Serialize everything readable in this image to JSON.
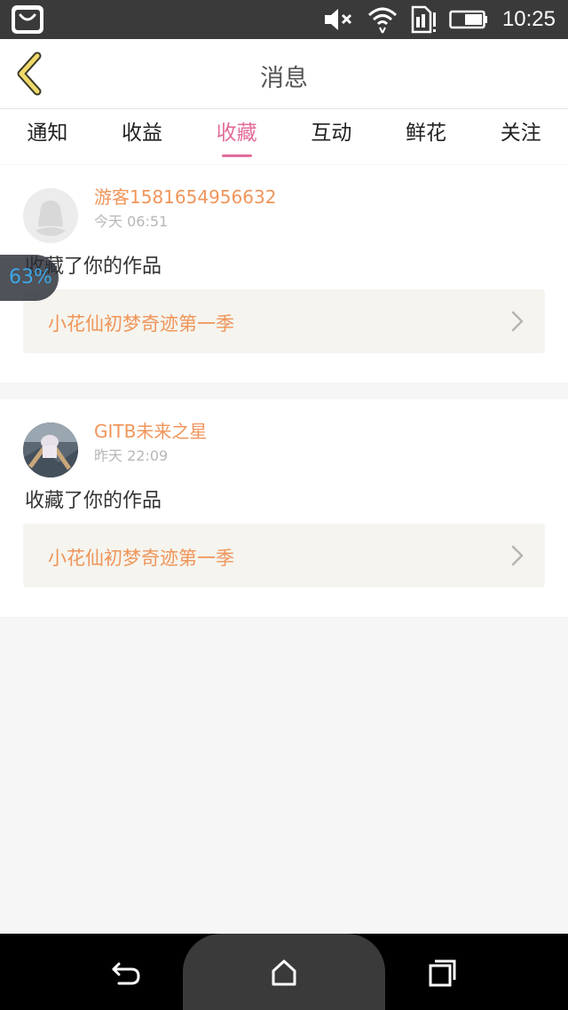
{
  "status_bar": {
    "time": "10:25",
    "icons": [
      "shopping-bag-icon",
      "volume-muted-icon",
      "wifi-icon",
      "sim-card-icon",
      "battery-icon"
    ]
  },
  "header": {
    "title": "消息",
    "back_icon": "chevron-left-icon"
  },
  "tabs": [
    {
      "label": "通知",
      "active": false
    },
    {
      "label": "收益",
      "active": false
    },
    {
      "label": "收藏",
      "active": true
    },
    {
      "label": "互动",
      "active": false
    },
    {
      "label": "鲜花",
      "active": false
    },
    {
      "label": "关注",
      "active": false
    }
  ],
  "floating_badge": {
    "text": "63%"
  },
  "messages": [
    {
      "username": "游客1581654956632",
      "time": "今天 06:51",
      "action": "收藏了你的作品",
      "work_title": "小花仙初梦奇迹第一季",
      "avatar": "default-avatar-icon"
    },
    {
      "username": "GITB未来之星",
      "time": "昨天 22:09",
      "action": "收藏了你的作品",
      "work_title": "小花仙初梦奇迹第一季",
      "avatar": "user-photo-avatar"
    }
  ],
  "colors": {
    "accent_pink": "#e36c9a",
    "accent_orange": "#f0955a",
    "back_arrow_yellow": "#f0d96a"
  },
  "nav_bar": {
    "icons": [
      "back-nav-icon",
      "home-nav-icon",
      "recents-nav-icon"
    ]
  }
}
